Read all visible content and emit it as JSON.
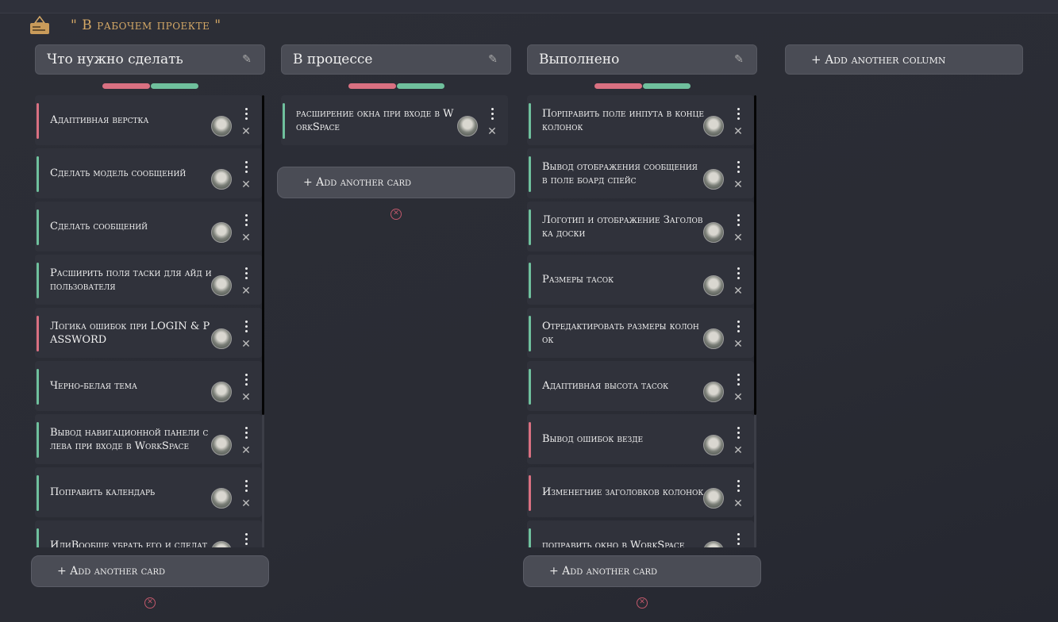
{
  "board": {
    "title": "\" В рабочем проекте \""
  },
  "icons": {
    "logo": "briefcase-icon",
    "edit": "pencil-icon",
    "menu": "kebab-menu-icon",
    "delete": "close-icon",
    "remove_column": "remove-circle-icon"
  },
  "colors": {
    "red_priority": "#d97081",
    "green_priority": "#6fc09d",
    "title": "#d4a866"
  },
  "columns": [
    {
      "title": "Что нужно сделать",
      "add_card_label": "+ Add another card",
      "cards": [
        {
          "text": "Адаптивная верстка",
          "priority": "red"
        },
        {
          "text": "Сделать модель сообщений",
          "priority": "green"
        },
        {
          "text": "Сделать сообщений",
          "priority": "green"
        },
        {
          "text": "Расширить поля таски для айд и пользователя",
          "priority": "green"
        },
        {
          "text": "Логика ошибок при LOGIN & PASSWORD",
          "priority": "red"
        },
        {
          "text": "Черно-белая тема",
          "priority": "green"
        },
        {
          "text": "Вывод навигационной панели слева при входе в WorkSpace",
          "priority": "green"
        },
        {
          "text": "Поправить календарь",
          "priority": "green"
        },
        {
          "text": "ИлиВообще убрать его и сделат",
          "priority": "green"
        }
      ]
    },
    {
      "title": "В процессе",
      "add_card_label": "+ Add another card",
      "cards": [
        {
          "text": "расширение окна при входе в WorkSpace",
          "priority": "green"
        }
      ]
    },
    {
      "title": "Выполнено",
      "add_card_label": "+ Add another card",
      "cards": [
        {
          "text": "Порправить поле инпута в конце колонок",
          "priority": "green"
        },
        {
          "text": "Вывод отображения сообщения в поле боард спейс",
          "priority": "green"
        },
        {
          "text": "Логотип и отображение Заголовка доски",
          "priority": "green"
        },
        {
          "text": "Размеры тасок",
          "priority": "green"
        },
        {
          "text": "Отредактировать размеры колонок",
          "priority": "green"
        },
        {
          "text": "Адаптивная высота тасок",
          "priority": "green"
        },
        {
          "text": "Вывод ошибок везде",
          "priority": "red"
        },
        {
          "text": "Изменегние заголовков колонок",
          "priority": "red"
        },
        {
          "text": "поправить окно в WorkSpace",
          "priority": "green"
        }
      ]
    }
  ],
  "add_column_label": "+ Add another column"
}
